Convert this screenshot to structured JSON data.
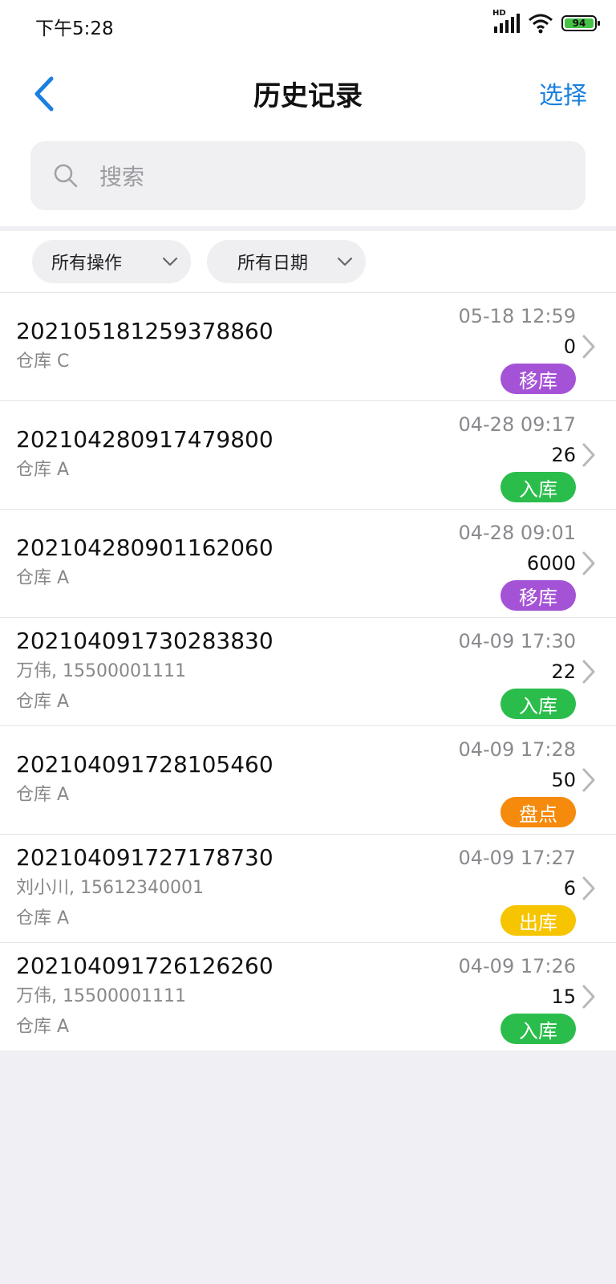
{
  "status": {
    "time": "下午5:28",
    "battery": "94",
    "hd": "HD"
  },
  "nav": {
    "title": "历史记录",
    "select_label": "选择"
  },
  "search": {
    "placeholder": "搜索"
  },
  "filters": {
    "operation": "所有操作",
    "date": "所有日期"
  },
  "colors": {
    "move": "#a553d6",
    "in": "#2bbd4c",
    "count": "#f58a0c",
    "out": "#f7c400",
    "accent": "#1a7fe0"
  },
  "records": [
    {
      "code": "202105181259378860",
      "lines": [
        "仓库 C"
      ],
      "date": "05-18 12:59",
      "qty": "0",
      "type": "移库",
      "type_key": "move"
    },
    {
      "code": "202104280917479800",
      "lines": [
        "仓库 A"
      ],
      "date": "04-28 09:17",
      "qty": "26",
      "type": "入库",
      "type_key": "in"
    },
    {
      "code": "202104280901162060",
      "lines": [
        "仓库 A"
      ],
      "date": "04-28 09:01",
      "qty": "6000",
      "type": "移库",
      "type_key": "move"
    },
    {
      "code": "202104091730283830",
      "lines": [
        "万伟, 15500001111",
        "仓库 A"
      ],
      "date": "04-09 17:30",
      "qty": "22",
      "type": "入库",
      "type_key": "in"
    },
    {
      "code": "202104091728105460",
      "lines": [
        "仓库 A"
      ],
      "date": "04-09 17:28",
      "qty": "50",
      "type": "盘点",
      "type_key": "count"
    },
    {
      "code": "202104091727178730",
      "lines": [
        "刘小川, 15612340001",
        "仓库 A"
      ],
      "date": "04-09 17:27",
      "qty": "6",
      "type": "出库",
      "type_key": "out"
    },
    {
      "code": "202104091726126260",
      "lines": [
        "万伟, 15500001111",
        "仓库 A"
      ],
      "date": "04-09 17:26",
      "qty": "15",
      "type": "入库",
      "type_key": "in"
    }
  ]
}
